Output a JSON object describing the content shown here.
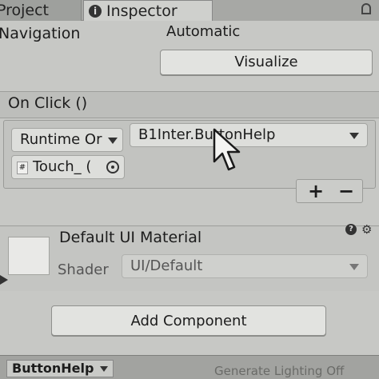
{
  "tabs": {
    "project": "Project",
    "inspector": "Inspector"
  },
  "navigation": {
    "label": "Navigation",
    "value": "Automatic",
    "visualize": "Visualize"
  },
  "on_click": {
    "header": "On Click ()",
    "runtime_mode": "Runtime Or",
    "function": "B1Inter.ButtonHelp",
    "object": "Touch_ (",
    "add": "+",
    "remove": "−"
  },
  "material": {
    "name": "Default UI Material",
    "shader_label": "Shader",
    "shader_value": "UI/Default"
  },
  "add_component": "Add Component",
  "bottom": {
    "object": "ButtonHelp",
    "overlay_text": "Generate Lighting Off"
  }
}
